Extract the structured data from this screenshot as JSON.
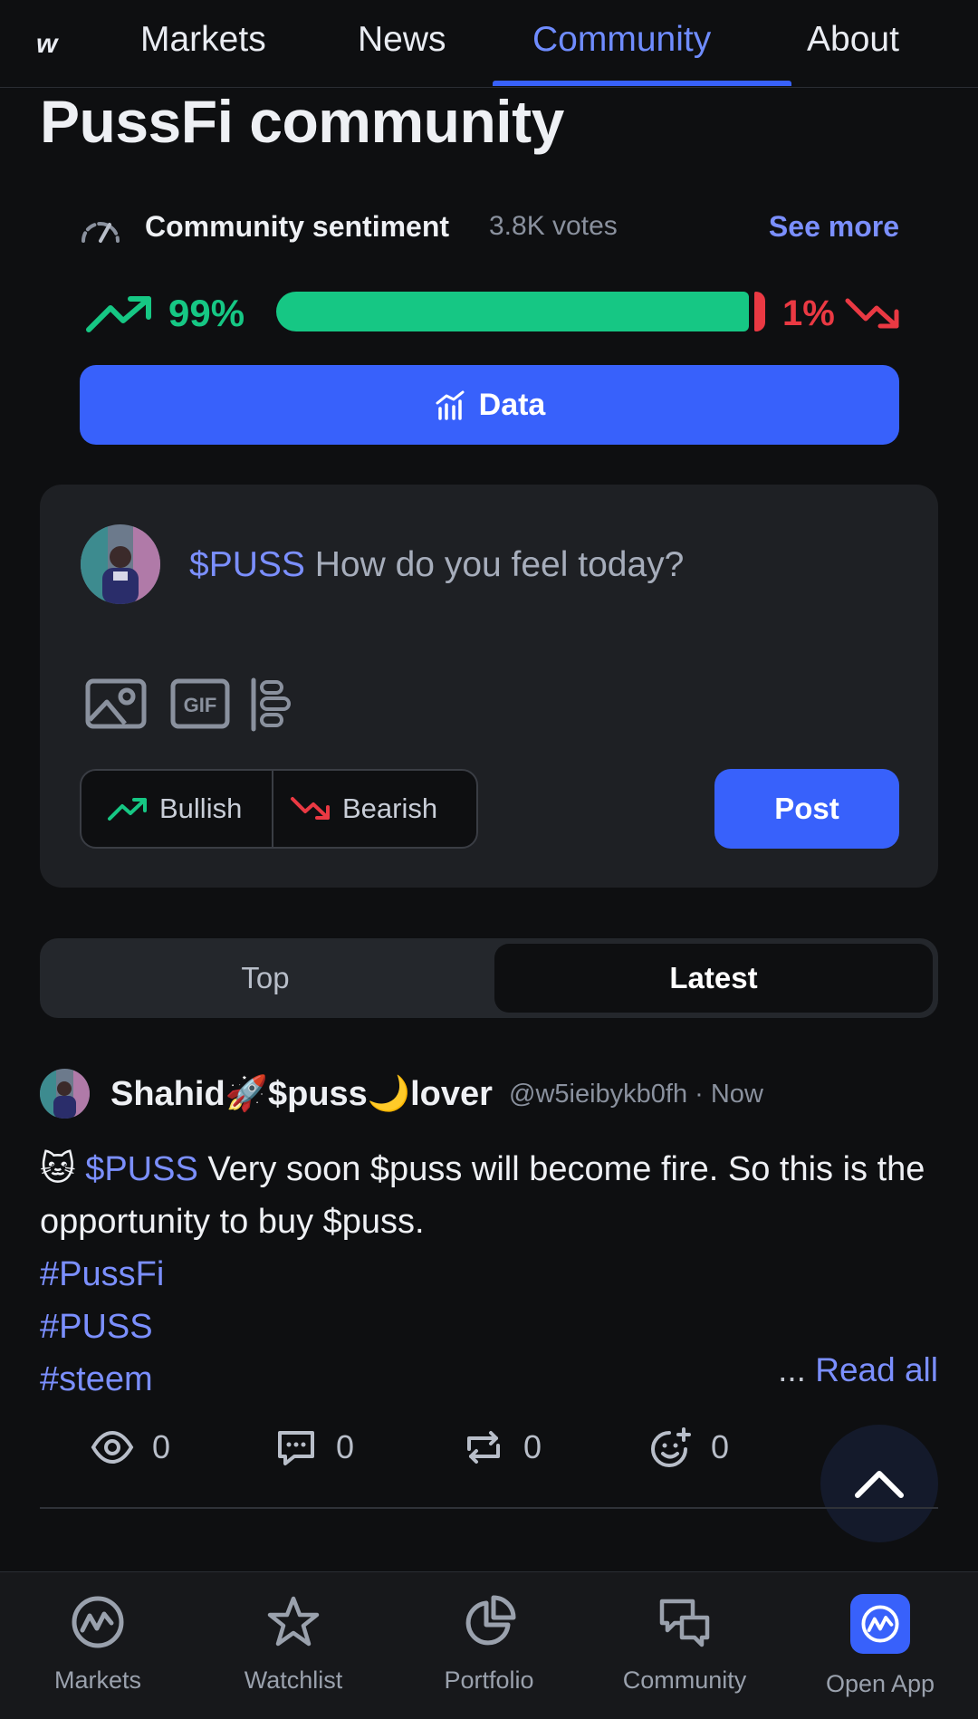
{
  "top_nav": {
    "cut_tab": "w",
    "tabs": [
      {
        "label": "Markets"
      },
      {
        "label": "News"
      },
      {
        "label": "Community",
        "active": true
      },
      {
        "label": "About"
      }
    ]
  },
  "page_title": "PussFi community",
  "sentiment": {
    "label": "Community sentiment",
    "votes": "3.8K votes",
    "see_more": "See more",
    "bullish_pct": "99%",
    "bearish_pct": "1%",
    "bullish_fraction": 0.99,
    "bearish_fraction": 0.01,
    "data_button": "Data"
  },
  "composer": {
    "ticker": "$PUSS",
    "placeholder": "How do you feel today?",
    "bullish_label": "Bullish",
    "bearish_label": "Bearish",
    "post_label": "Post"
  },
  "sort_tabs": {
    "top": "Top",
    "latest": "Latest"
  },
  "post": {
    "author": "Shahid🚀$puss🌙lover",
    "handle": "@w5ieibykb0fh · Now",
    "ticker": "$PUSS",
    "text": " Very soon $puss will become fire. So this is the opportunity to buy $puss.",
    "hashtags": [
      "#PussFi",
      "#PUSS",
      "#steem"
    ],
    "ellipsis": "... ",
    "read_all": "Read all",
    "views": "0",
    "comments": "0",
    "reposts": "0",
    "reactions": "0",
    "more": "···"
  },
  "bottom_nav": [
    {
      "label": "Markets",
      "icon": "cmc-logo-icon"
    },
    {
      "label": "Watchlist",
      "icon": "star-icon"
    },
    {
      "label": "Portfolio",
      "icon": "pie-chart-icon"
    },
    {
      "label": "Community",
      "icon": "chat-bubbles-icon"
    },
    {
      "label": "Open App",
      "icon": "cmc-app-icon"
    }
  ],
  "colors": {
    "background": "#0e0f11",
    "accent": "#3861fb",
    "link": "#7b8fff",
    "bullish": "#16c784",
    "bearish": "#ea3943",
    "card": "#1e2024"
  }
}
